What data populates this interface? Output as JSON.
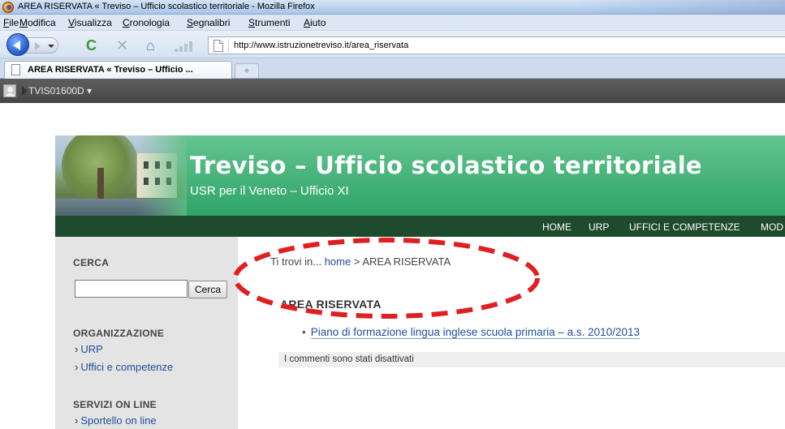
{
  "window": {
    "title": "AREA RISERVATA « Treviso – Ufficio scolastico territoriale - Mozilla Firefox"
  },
  "menubar": {
    "items": [
      {
        "underlined": "F",
        "rest": "ile"
      },
      {
        "underlined": "M",
        "rest": "odifica"
      },
      {
        "underlined": "V",
        "rest": "isualizza"
      },
      {
        "underlined": "C",
        "rest": "ronologia"
      },
      {
        "underlined": "S",
        "rest": "egnalibri"
      },
      {
        "underlined": "S",
        "rest": "trumenti"
      },
      {
        "underlined": "A",
        "rest": "iuto"
      }
    ]
  },
  "navbar": {
    "url": "http://www.istruzionetreviso.it/area_riservata",
    "icons": [
      "back-icon",
      "forward-icon",
      "reload-icon",
      "stop-icon",
      "home-icon",
      "signal-icon"
    ],
    "reload_glyph": "C",
    "stop_glyph": "✕",
    "home_glyph": "⌂"
  },
  "tabs": {
    "active_title": "AREA RISERVATA « Treviso – Ufficio ...",
    "new_tab_glyph": "+"
  },
  "adminbar": {
    "user": "TVIS01600D ▾"
  },
  "site": {
    "title": "Treviso – Ufficio scolastico territoriale",
    "subtitle": "USR per il Veneto – Ufficio XI",
    "nav": [
      "HOME",
      "URP",
      "UFFICI E COMPETENZE",
      "MOD"
    ]
  },
  "sidebar": {
    "search_title": "CERCA",
    "search_value": "",
    "search_button": "Cerca",
    "org_title": "ORGANIZZAZIONE",
    "org_links": [
      "URP",
      "Uffici e competenze"
    ],
    "services_title": "SERVIZI ON LINE",
    "services_links": [
      "Sportello on line"
    ],
    "chevron": "›"
  },
  "content": {
    "breadcrumb_prefix": "Ti trovi in... ",
    "breadcrumb_home": "home",
    "breadcrumb_sep": " > ",
    "breadcrumb_current": "AREA RISERVATA",
    "heading": "AREA RISERVATA",
    "posts": [
      "Piano di formazione lingua inglese scuola primaria – a.s. 2010/2013"
    ],
    "bullet": "•",
    "comments_note": "I commenti sono stati disattivati"
  },
  "colors": {
    "header_green": "#2fa468",
    "nav_dark_green": "#1e4a2d",
    "link_blue": "#1f4e96",
    "annotation_red": "#e02020"
  }
}
